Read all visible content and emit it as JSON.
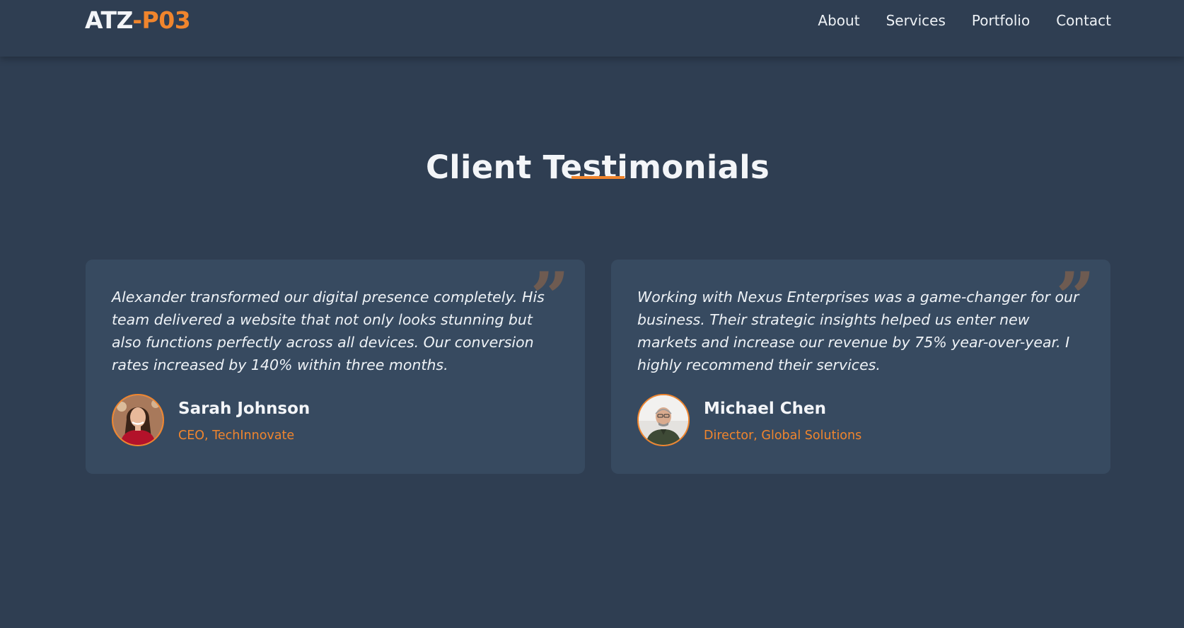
{
  "brand": {
    "logo_primary": "ATZ",
    "logo_accent": "-P03",
    "accent_color": "#f0852d",
    "background_color": "#2f3e52",
    "card_color": "#374a60"
  },
  "nav": {
    "items": [
      {
        "label": "About"
      },
      {
        "label": "Services"
      },
      {
        "label": "Portfolio"
      },
      {
        "label": "Contact"
      }
    ]
  },
  "section": {
    "title": "Client Testimonials"
  },
  "testimonials": [
    {
      "quote": "Alexander transformed our digital presence completely. His team delivered a website that not only looks stunning but also functions perfectly across all devices. Our conversion rates increased by 140% within three months.",
      "name": "Sarah Johnson",
      "role": "CEO, TechInnovate",
      "quote_icon": "quote-icon",
      "avatar_icon": "avatar-photo"
    },
    {
      "quote": "Working with Nexus Enterprises was a game-changer for our business. Their strategic insights helped us enter new markets and increase our revenue by 75% year-over-year. I highly recommend their services.",
      "name": "Michael Chen",
      "role": "Director, Global Solutions",
      "quote_icon": "quote-icon",
      "avatar_icon": "avatar-photo"
    }
  ]
}
